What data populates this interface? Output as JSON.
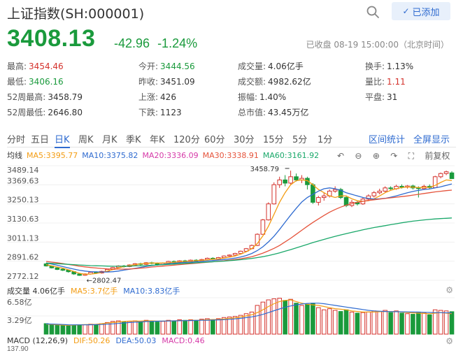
{
  "header": {
    "title": "上证指数(SH:000001)",
    "add_label": "已添加",
    "check": "✓"
  },
  "quote": {
    "price": "3408.13",
    "change": "-42.96",
    "change_pct": "-1.24%",
    "status": "已收盘 08-19 15:00:00（北京时间）"
  },
  "stats": [
    {
      "label": "最高:",
      "value": "3454.46",
      "color": "red"
    },
    {
      "label": "今开:",
      "value": "3444.56",
      "color": "green"
    },
    {
      "label": "成交量:",
      "value": "4.06亿手",
      "color": ""
    },
    {
      "label": "换手:",
      "value": "1.13%",
      "color": ""
    },
    {
      "label": "最低:",
      "value": "3406.16",
      "color": "green"
    },
    {
      "label": "昨收:",
      "value": "3451.09",
      "color": ""
    },
    {
      "label": "成交额:",
      "value": "4982.62亿",
      "color": ""
    },
    {
      "label": "量比:",
      "value": "1.11",
      "color": "red"
    },
    {
      "label": "52周最高:",
      "value": "3458.79",
      "color": ""
    },
    {
      "label": "上涨:",
      "value": "426",
      "color": ""
    },
    {
      "label": "振幅:",
      "value": "1.40%",
      "color": ""
    },
    {
      "label": "平盘:",
      "value": "31",
      "color": ""
    },
    {
      "label": "52周最低:",
      "value": "2646.80",
      "color": ""
    },
    {
      "label": "下跌:",
      "value": "1123",
      "color": ""
    },
    {
      "label": "总市值:",
      "value": "43.45万亿",
      "color": ""
    }
  ],
  "tabs": [
    "分时",
    "五日",
    "日K",
    "周K",
    "月K",
    "季K",
    "年K",
    "120分",
    "60分",
    "30分",
    "15分",
    "5分",
    "1分"
  ],
  "active_tab": "日K",
  "tab_links": [
    "区间统计",
    "全屏显示"
  ],
  "ma": [
    {
      "label": "均线",
      "color": "#333333"
    },
    {
      "label": "MA5:3395.77",
      "color": "#f39c12"
    },
    {
      "label": "MA10:3375.82",
      "color": "#2f6bd0"
    },
    {
      "label": "MA20:3336.09",
      "color": "#d63aa8"
    },
    {
      "label": "MA30:3338.91",
      "color": "#e5533b"
    },
    {
      "label": "MA60:3161.92",
      "color": "#1aa86a"
    }
  ],
  "tools": {
    "prev": "↶",
    "zoom_out": "⊖",
    "zoom_in": "⊕",
    "next": "↷",
    "fullscreen": "⛶",
    "adjust": "前复权"
  },
  "vol": [
    {
      "label": "成交量 4.06亿手",
      "color": "#333333"
    },
    {
      "label": "MA5:3.7亿手",
      "color": "#f39c12"
    },
    {
      "label": "MA10:3.83亿手",
      "color": "#2f6bd0"
    }
  ],
  "macd": [
    {
      "label": "MACD (12,26,9)",
      "color": "#333333"
    },
    {
      "label": "DIF:50.26",
      "color": "#f39c12"
    },
    {
      "label": "DEA:50.03",
      "color": "#2f6bd0"
    },
    {
      "label": "MACD:0.46",
      "color": "#d63aa8"
    }
  ],
  "macd_tick": "137.90",
  "gear": "⚙",
  "chart_data": {
    "type": "candlestick",
    "y_ticks": [
      "3489.14",
      "3369.63",
      "3250.13",
      "3130.63",
      "3011.13",
      "2891.62",
      "2772.12"
    ],
    "ylim": [
      2772.12,
      3489.14
    ],
    "high_label": "3458.79",
    "low_label": "2802.47",
    "vol_ticks": [
      "6.58亿",
      "3.29亿"
    ],
    "vol_max": 6.58,
    "candles": [
      [
        2875,
        2862,
        2880,
        2858,
        1.9
      ],
      [
        2862,
        2850,
        2866,
        2846,
        1.8
      ],
      [
        2850,
        2840,
        2855,
        2836,
        1.7
      ],
      [
        2842,
        2835,
        2847,
        2830,
        1.6
      ],
      [
        2836,
        2826,
        2840,
        2820,
        1.5
      ],
      [
        2826,
        2812,
        2830,
        2806,
        1.6
      ],
      [
        2812,
        2803,
        2818,
        2800,
        1.7
      ],
      [
        2804,
        2812,
        2816,
        2800,
        1.7
      ],
      [
        2812,
        2822,
        2826,
        2808,
        1.8
      ],
      [
        2822,
        2818,
        2828,
        2812,
        1.7
      ],
      [
        2818,
        2828,
        2832,
        2814,
        1.9
      ],
      [
        2828,
        2840,
        2844,
        2824,
        2.1
      ],
      [
        2840,
        2852,
        2856,
        2836,
        2.3
      ],
      [
        2852,
        2862,
        2866,
        2848,
        2.4
      ],
      [
        2862,
        2858,
        2868,
        2852,
        2.2
      ],
      [
        2858,
        2868,
        2872,
        2854,
        2.3
      ],
      [
        2868,
        2876,
        2880,
        2862,
        2.4
      ],
      [
        2876,
        2872,
        2882,
        2866,
        2.3
      ],
      [
        2872,
        2882,
        2886,
        2868,
        2.5
      ],
      [
        2882,
        2878,
        2888,
        2872,
        2.4
      ],
      [
        2878,
        2870,
        2884,
        2864,
        2.2
      ],
      [
        2870,
        2880,
        2884,
        2866,
        2.3
      ],
      [
        2880,
        2890,
        2894,
        2876,
        2.5
      ],
      [
        2890,
        2884,
        2896,
        2878,
        2.4
      ],
      [
        2884,
        2894,
        2898,
        2880,
        2.6
      ],
      [
        2894,
        2888,
        2900,
        2882,
        2.5
      ],
      [
        2888,
        2898,
        2902,
        2884,
        2.6
      ],
      [
        2898,
        2892,
        2904,
        2886,
        2.5
      ],
      [
        2892,
        2902,
        2906,
        2888,
        2.7
      ],
      [
        2902,
        2910,
        2914,
        2898,
        2.8
      ],
      [
        2910,
        2904,
        2916,
        2900,
        2.6
      ],
      [
        2904,
        2914,
        2918,
        2900,
        2.8
      ],
      [
        2914,
        2924,
        2928,
        2910,
        3.0
      ],
      [
        2924,
        2930,
        2934,
        2920,
        3.1
      ],
      [
        2930,
        2940,
        2944,
        2926,
        3.2
      ],
      [
        2940,
        2954,
        2958,
        2936,
        3.4
      ],
      [
        2954,
        2970,
        2974,
        2950,
        3.7
      ],
      [
        2970,
        2990,
        2996,
        2966,
        4.0
      ],
      [
        2990,
        3060,
        3066,
        2986,
        5.2
      ],
      [
        3060,
        3150,
        3156,
        3056,
        5.8
      ],
      [
        3150,
        3250,
        3260,
        3146,
        6.2
      ],
      [
        3250,
        3370,
        3385,
        3246,
        6.4
      ],
      [
        3370,
        3400,
        3420,
        3350,
        6.5
      ],
      [
        3400,
        3380,
        3430,
        3360,
        6.1
      ],
      [
        3380,
        3420,
        3458,
        3372,
        6.3
      ],
      [
        3420,
        3400,
        3440,
        3390,
        5.6
      ],
      [
        3400,
        3410,
        3430,
        3380,
        5.2
      ],
      [
        3410,
        3370,
        3420,
        3340,
        5.4
      ],
      [
        3370,
        3260,
        3380,
        3250,
        5.6
      ],
      [
        3260,
        3290,
        3300,
        3240,
        4.8
      ],
      [
        3290,
        3300,
        3320,
        3270,
        4.4
      ],
      [
        3300,
        3330,
        3340,
        3290,
        4.6
      ],
      [
        3330,
        3340,
        3360,
        3320,
        4.3
      ],
      [
        3340,
        3290,
        3350,
        3280,
        4.1
      ],
      [
        3290,
        3240,
        3300,
        3230,
        4.4
      ],
      [
        3240,
        3260,
        3275,
        3230,
        4.0
      ],
      [
        3260,
        3250,
        3270,
        3240,
        3.8
      ],
      [
        3250,
        3280,
        3290,
        3244,
        3.9
      ],
      [
        3280,
        3300,
        3310,
        3270,
        4.0
      ],
      [
        3300,
        3320,
        3330,
        3290,
        4.2
      ],
      [
        3320,
        3330,
        3345,
        3310,
        4.1
      ],
      [
        3330,
        3350,
        3360,
        3320,
        4.3
      ],
      [
        3350,
        3345,
        3360,
        3335,
        3.9
      ],
      [
        3345,
        3360,
        3370,
        3338,
        4.2
      ],
      [
        3360,
        3355,
        3372,
        3346,
        3.8
      ],
      [
        3355,
        3362,
        3368,
        3346,
        3.7
      ],
      [
        3362,
        3350,
        3370,
        3340,
        3.6
      ],
      [
        3350,
        3346,
        3360,
        3290,
        4.0
      ],
      [
        3346,
        3360,
        3370,
        3340,
        3.8
      ],
      [
        3360,
        3352,
        3372,
        3344,
        3.5
      ],
      [
        3352,
        3420,
        3426,
        3350,
        4.4
      ],
      [
        3420,
        3440,
        3446,
        3410,
        4.3
      ],
      [
        3440,
        3451,
        3458,
        3430,
        4.2
      ],
      [
        3444,
        3408,
        3454,
        3406,
        4.06
      ]
    ],
    "ma_lines": {
      "ma5": [
        2870,
        2862,
        2855,
        2848,
        2838,
        2827,
        2816,
        2810,
        2811,
        2815,
        2822,
        2830,
        2839,
        2849,
        2858,
        2865,
        2870,
        2875,
        2878,
        2880,
        2880,
        2880,
        2882,
        2885,
        2888,
        2890,
        2892,
        2895,
        2897,
        2900,
        2904,
        2906,
        2911,
        2917,
        2924,
        2935,
        2950,
        2970,
        3002,
        3050,
        3110,
        3185,
        3260,
        3320,
        3370,
        3395,
        3400,
        3396,
        3370,
        3340,
        3320,
        3300,
        3290,
        3300,
        3300,
        3282,
        3270,
        3266,
        3270,
        3282,
        3300,
        3320,
        3335,
        3345,
        3352,
        3356,
        3355,
        3352,
        3354,
        3353,
        3366,
        3384,
        3400,
        3396
      ],
      "ma10": [
        2880,
        2874,
        2866,
        2858,
        2850,
        2842,
        2835,
        2830,
        2826,
        2825,
        2824,
        2824,
        2826,
        2830,
        2836,
        2841,
        2847,
        2853,
        2859,
        2864,
        2868,
        2872,
        2876,
        2879,
        2882,
        2884,
        2886,
        2888,
        2890,
        2893,
        2896,
        2899,
        2902,
        2906,
        2911,
        2918,
        2927,
        2940,
        2958,
        2982,
        3012,
        3048,
        3090,
        3135,
        3180,
        3222,
        3262,
        3290,
        3310,
        3330,
        3345,
        3350,
        3345,
        3335,
        3320,
        3310,
        3300,
        3290,
        3284,
        3280,
        3282,
        3285,
        3292,
        3300,
        3310,
        3320,
        3328,
        3335,
        3340,
        3343,
        3350,
        3357,
        3366,
        3375
      ],
      "ma20": [
        2890,
        2886,
        2882,
        2877,
        2871,
        2866,
        2860,
        2856,
        2852,
        2849,
        2846,
        2844,
        2843,
        2842,
        2842,
        2843,
        2845,
        2848,
        2851,
        2855,
        2858,
        2861,
        2864,
        2867,
        2870,
        2873,
        2876,
        2879,
        2882,
        2885,
        2888,
        2891,
        2894,
        2898,
        2902,
        2907,
        2913,
        2920,
        2930,
        2942,
        2956,
        2972,
        2990,
        3012,
        3035,
        3060,
        3085,
        3110,
        3134,
        3156,
        3178,
        3198,
        3215,
        3230,
        3242,
        3252,
        3260,
        3266,
        3272,
        3276,
        3280,
        3284,
        3288,
        3292,
        3296,
        3300,
        3305,
        3310,
        3315,
        3320,
        3325,
        3329,
        3333,
        3336
      ],
      "ma60": [
        2880,
        2878,
        2876,
        2874,
        2872,
        2870,
        2868,
        2866,
        2864,
        2863,
        2862,
        2861,
        2860,
        2860,
        2860,
        2861,
        2862,
        2863,
        2864,
        2866,
        2868,
        2870,
        2872,
        2874,
        2876,
        2878,
        2880,
        2882,
        2884,
        2886,
        2888,
        2890,
        2892,
        2895,
        2898,
        2901,
        2905,
        2909,
        2914,
        2920,
        2927,
        2935,
        2944,
        2954,
        2964,
        2975,
        2986,
        2997,
        3008,
        3018,
        3028,
        3038,
        3047,
        3056,
        3064,
        3072,
        3080,
        3088,
        3095,
        3102,
        3108,
        3114,
        3120,
        3126,
        3132,
        3137,
        3142,
        3146,
        3150,
        3153,
        3156,
        3158,
        3160,
        3162
      ]
    },
    "vol_ma": {
      "ma5": [
        1.8,
        1.75,
        1.7,
        1.65,
        1.6,
        1.65,
        1.7,
        1.72,
        1.75,
        1.8,
        1.9,
        2.0,
        2.1,
        2.2,
        2.3,
        2.35,
        2.35,
        2.35,
        2.4,
        2.4,
        2.35,
        2.35,
        2.4,
        2.4,
        2.45,
        2.45,
        2.5,
        2.5,
        2.55,
        2.6,
        2.65,
        2.65,
        2.75,
        2.85,
        2.95,
        3.1,
        3.3,
        3.5,
        3.9,
        4.4,
        5.0,
        5.5,
        5.9,
        6.1,
        6.2,
        5.9,
        5.6,
        5.4,
        5.3,
        5.2,
        5.0,
        4.8,
        4.6,
        4.5,
        4.4,
        4.2,
        4.1,
        4.0,
        4.0,
        4.0,
        4.05,
        4.1,
        4.1,
        4.1,
        4.0,
        3.9,
        3.85,
        3.8,
        3.75,
        3.7,
        3.8,
        3.9,
        3.8,
        3.7
      ],
      "ma10": [
        1.85,
        1.82,
        1.78,
        1.74,
        1.7,
        1.68,
        1.68,
        1.68,
        1.7,
        1.72,
        1.75,
        1.8,
        1.86,
        1.94,
        2.02,
        2.1,
        2.16,
        2.22,
        2.28,
        2.32,
        2.34,
        2.36,
        2.38,
        2.4,
        2.42,
        2.44,
        2.46,
        2.48,
        2.5,
        2.52,
        2.55,
        2.58,
        2.62,
        2.68,
        2.76,
        2.86,
        2.98,
        3.12,
        3.32,
        3.58,
        3.9,
        4.24,
        4.56,
        4.86,
        5.1,
        5.3,
        5.45,
        5.55,
        5.6,
        5.6,
        5.5,
        5.35,
        5.2,
        5.05,
        4.9,
        4.75,
        4.6,
        4.45,
        4.3,
        4.2,
        4.15,
        4.1,
        4.08,
        4.06,
        4.04,
        4.02,
        4.0,
        3.98,
        3.95,
        3.92,
        3.9,
        3.88,
        3.86,
        3.83
      ]
    }
  }
}
